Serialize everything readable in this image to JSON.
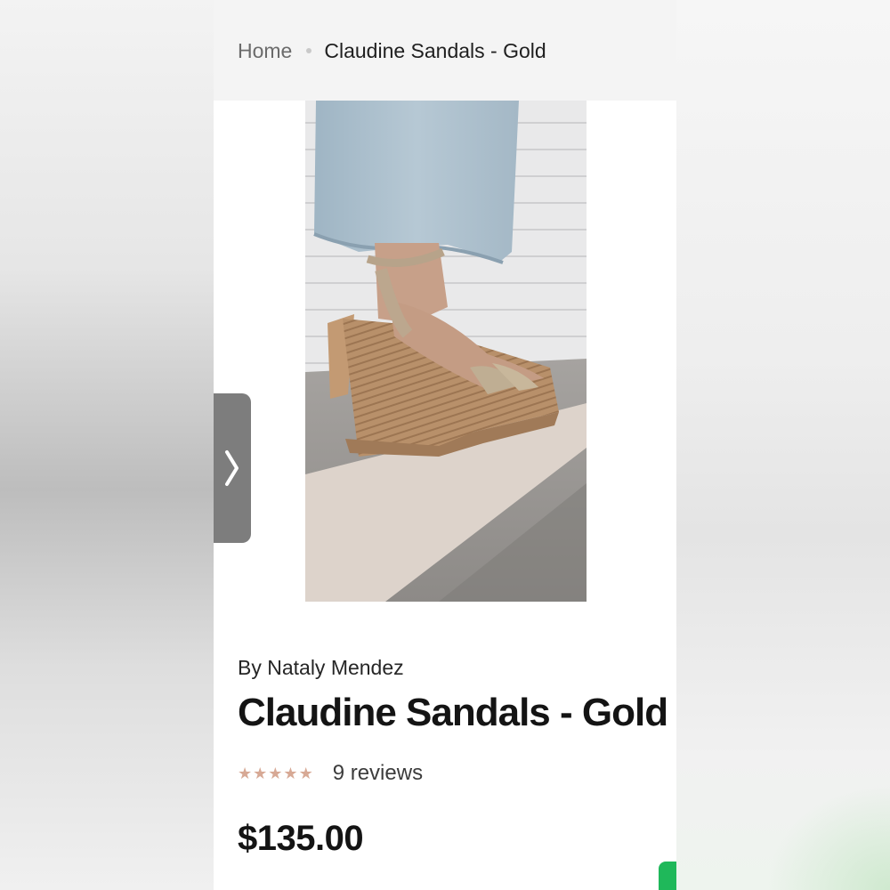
{
  "breadcrumb": {
    "home_label": "Home",
    "current_label": "Claudine Sandals - Gold"
  },
  "product": {
    "brand_line": "By Nataly Mendez",
    "title": "Claudine Sandals - Gold",
    "rating": {
      "stars_filled": 5,
      "stars_total": 5
    },
    "reviews_label": "9 reviews",
    "price": "$135.00",
    "image_alt": "Claudine Sandals - Gold"
  },
  "carousel": {
    "next_icon": "chevron-right-icon"
  },
  "colors": {
    "star": "#d7a995",
    "carousel_button": "#7d7d7d",
    "header_background": "#f4f4f4",
    "chat_button": "#1fb85a"
  }
}
